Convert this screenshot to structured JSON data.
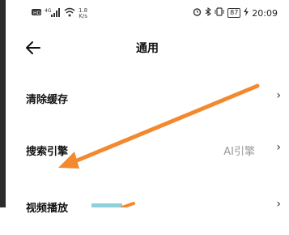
{
  "status_bar": {
    "net_type": "4G",
    "net_speed_value": "1.8",
    "net_speed_unit": "K/s",
    "battery_level": "87",
    "time": "20:09"
  },
  "app_bar": {
    "title": "通用"
  },
  "settings": [
    {
      "label": "清除缓存",
      "value": ""
    },
    {
      "label": "搜索引擎",
      "value": "AI引擎"
    },
    {
      "label": "视频播放",
      "value": ""
    }
  ],
  "annotation_color": "#F3892E"
}
